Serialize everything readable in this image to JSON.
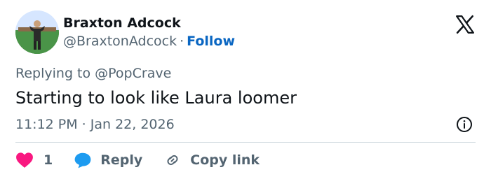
{
  "author": {
    "name": "Braxton Adcock",
    "handle": "@BraxtonAdcock",
    "separator": "·",
    "follow_label": "Follow"
  },
  "tweet": {
    "reply_to": "Replying to @PopCrave",
    "text": "Starting to look like Laura loomer",
    "timestamp": "11:12 PM · Jan 22, 2026"
  },
  "actions": {
    "like_count": "1",
    "reply_label": "Reply",
    "copy_link_label": "Copy link"
  },
  "colors": {
    "heart": "#f91880",
    "reply_bubble": "#1d9bf0",
    "follow": "#0a66c2",
    "muted": "#536471",
    "text": "#0f1419",
    "divider": "#cfd9de"
  },
  "icons": [
    "x-logo-icon",
    "info-icon",
    "heart-icon",
    "reply-bubble-icon",
    "link-icon"
  ]
}
